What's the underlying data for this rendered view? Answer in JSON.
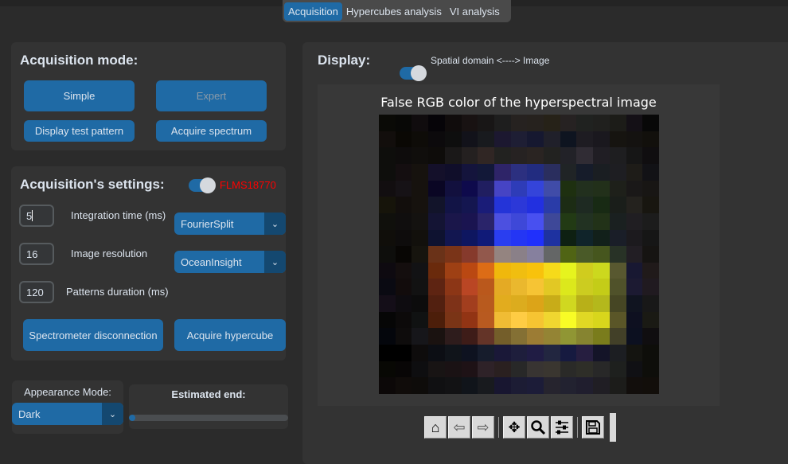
{
  "tabs": [
    {
      "label": "Acquisition",
      "selected": true
    },
    {
      "label": "Hypercubes analysis"
    },
    {
      "label": "VI analysis"
    }
  ],
  "acq_mode": {
    "title": "Acquisition mode:",
    "simple": "Simple",
    "expert": "Expert",
    "test_pattern": "Display test pattern",
    "acquire_spectrum": "Acquire spectrum"
  },
  "settings": {
    "title": "Acquisition's settings:",
    "spectrometer": "FLMS18770",
    "spectrometer_color": "#ff0000",
    "switch_on": true,
    "integration_value": "5",
    "integration_label": "Integration time (ms)",
    "resolution_value": "16",
    "resolution_label": "Image resolution",
    "duration_value": "120",
    "duration_label": "Patterns duration (ms)",
    "pattern_method": "FourierSplit",
    "spectrometer_brand": "OceanInsight",
    "disconnect": "Spectrometer disconnection",
    "acquire_hypercube": "Acquire hypercube"
  },
  "appearance": {
    "label": "Appearance Mode:",
    "value": "Dark"
  },
  "estimated": {
    "label": "Estimated end:",
    "progress": 0.0
  },
  "display": {
    "label": "Display:",
    "switch_label": "Spatial domain <----> Image",
    "switch_on": true
  },
  "figure": {
    "title": "False RGB color of the hyperspectral image",
    "pixels": [
      [
        "0a0a06",
        "080806",
        "100c0e",
        "060408",
        "100c0c",
        "181212",
        "181616",
        "1e1e1e",
        "262220",
        "26221e",
        "262218",
        "262222",
        "202220",
        "20201e",
        "1c1c18",
        "141016",
        "080808"
      ],
      [
        "120e0c",
        "0a0804",
        "0e0c08",
        "0c0a0c",
        "0e0e0e",
        "12121a",
        "181a1e",
        "1c1830",
        "1e1e34",
        "161830",
        "20202a",
        "0e1420",
        "1e1c22",
        "1a181e",
        "161410",
        "141210",
        "12100c"
      ],
      [
        "0e0e0c",
        "0e0c0c",
        "100e0c",
        "0e0c0a",
        "1a1818",
        "242020",
        "302624",
        "222220",
        "262222",
        "2a2422",
        "222220",
        "222228",
        "302c34",
        "201e24",
        "1e1e20",
        "161616",
        "100e10"
      ],
      [
        "0e0e0c",
        "140e10",
        "16120e",
        "14102a",
        "100e2a",
        "14143c",
        "121838",
        "2e2468",
        "2c3080",
        "222c80",
        "2a2e5e",
        "202426",
        "161c2a",
        "1a1e22",
        "1e1e22",
        "1e1c18",
        "121216"
      ],
      [
        "120e10",
        "161216",
        "16120e",
        "0a0624",
        "12103e",
        "0e0a4c",
        "201e60",
        "4644c4",
        "2e3cb8",
        "3444da",
        "404ca8",
        "1e3010",
        "22301e",
        "22301a",
        "1e201a",
        "1a1818",
        "181614"
      ],
      [
        "16140a",
        "120e0c",
        "16120e",
        "12142a",
        "121446",
        "141650",
        "1a1c78",
        "2434d8",
        "2c38d8",
        "2230e0",
        "2a3ca8",
        "1c2c14",
        "1e2a22",
        "182a14",
        "1a1e1a",
        "24221e",
        "181610"
      ],
      [
        "10100c",
        "100e0e",
        "141210",
        "141434",
        "1a164a",
        "1a1450",
        "2a246a",
        "4c50e0",
        "3e48d8",
        "4850f0",
        "3e4898",
        "223a14",
        "223222",
        "223218",
        "1a2020",
        "201e22",
        "1c1c1c"
      ],
      [
        "100e0a",
        "0e0c0c",
        "12100c",
        "0e1230",
        "121650",
        "0e1660",
        "101a78",
        "2a3ef0",
        "2436f4",
        "2030fc",
        "1e32a0",
        "0e2012",
        "10242a",
        "12201a",
        "1a1e28",
        "1c1a1e",
        "161616"
      ],
      [
        "0e0e0c",
        "080604",
        "16140e",
        "6a3218",
        "7a3418",
        "863a2c",
        "92584c",
        "948480",
        "8a8088",
        "86809e",
        "646666",
        "506414",
        "4a5a28",
        "46561e",
        "283226",
        "221e24",
        "161412"
      ],
      [
        "0e0a10",
        "140e0e",
        "121214",
        "6a2a0c",
        "9e4014",
        "ba4812",
        "dc6c16",
        "f0b80c",
        "f0be10",
        "f8c20c",
        "f6da1a",
        "e6f41e",
        "d0cc1e",
        "ccd81e",
        "585830",
        "181832",
        "201a1a"
      ],
      [
        "0a0a12",
        "120c0c",
        "121212",
        "5e2412",
        "8c3616",
        "ba4624",
        "ba581c",
        "e4aa24",
        "eab82e",
        "f6c434",
        "e2c824",
        "dce81c",
        "cccc20",
        "c4cc18",
        "50522a",
        "1c1a32",
        "201a20"
      ],
      [
        "140e18",
        "0e0c10",
        "0c0c0c",
        "522010",
        "7e3218",
        "a23e1e",
        "b85a1e",
        "e2ac1e",
        "dcac1e",
        "dca418",
        "c8ac18",
        "d0d820",
        "b8b018",
        "b4b81c",
        "464624",
        "101420",
        "181818"
      ],
      [
        "060606",
        "0c0a0a",
        "101212",
        "4c1e0a",
        "7a3416",
        "923414",
        "b85a20",
        "f0bc34",
        "fecc44",
        "f6c432",
        "f0d630",
        "f8fc26",
        "e0d824",
        "d8d61c",
        "5a5628",
        "0e1020",
        "1a1a14"
      ],
      [
        "04060c",
        "0e0c0c",
        "16161a",
        "1a1210",
        "2e1c1c",
        "3e1c18",
        "643428",
        "745e2a",
        "847034",
        "9c7c34",
        "948434",
        "909634",
        "868430",
        "7a7c1c",
        "424028",
        "0c1020",
        "100e10"
      ],
      [
        "000000",
        "000000",
        "0e0c0c",
        "0c0e14",
        "10141a",
        "0e1220",
        "161c2c",
        "1a1838",
        "1e1e3c",
        "201c44",
        "222640",
        "161a40",
        "261e40",
        "141428",
        "1c1e22",
        "141410",
        "0e0e0a"
      ],
      [
        "080804",
        "080606",
        "0e0e10",
        "181414",
        "1a1214",
        "1e1216",
        "2e2228",
        "2a2020",
        "282828",
        "383432",
        "3a3630",
        "2a2a28",
        "2e2e28",
        "282828",
        "1e201e",
        "101014",
        "0e0e0a"
      ],
      [
        "0c0808",
        "100c0a",
        "0e0c0a",
        "101012",
        "121214",
        "10141a",
        "181a1e",
        "181630",
        "1c1c34",
        "1c1c38",
        "26242e",
        "222230",
        "201e2e",
        "201e24",
        "1c1c1a",
        "120e0c",
        "120e0a"
      ]
    ]
  },
  "toolbar": {
    "home": "home-icon",
    "back": "arrow-left-icon",
    "forward": "arrow-right-icon",
    "pan": "move-icon",
    "zoom": "magnifier-icon",
    "configure": "sliders-icon",
    "save": "floppy-icon"
  }
}
